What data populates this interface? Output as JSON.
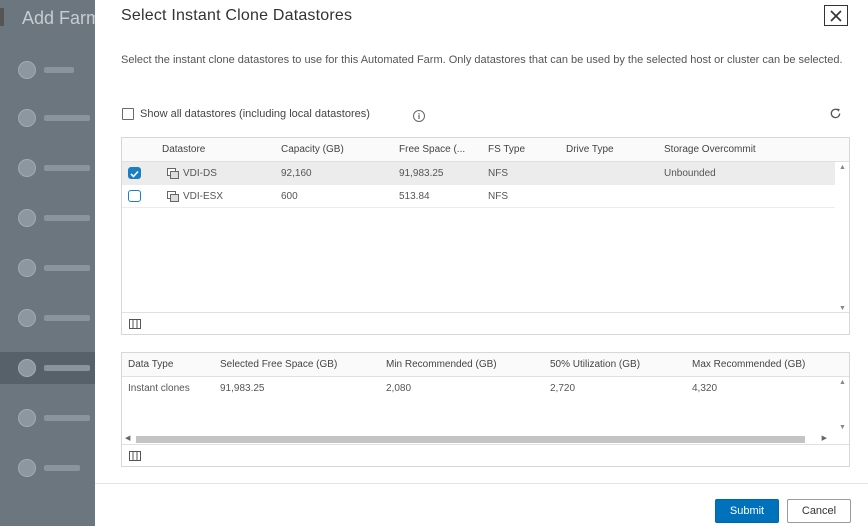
{
  "background": {
    "title": "Add Farm"
  },
  "modal": {
    "title": "Select Instant Clone Datastores",
    "description": "Select the instant clone datastores to use for this Automated Farm. Only datastores that can be used by the selected host or cluster can be selected.",
    "show_all_label": "Show all datastores (including local datastores)",
    "info_icon": "i"
  },
  "datastore_grid": {
    "columns": [
      "Datastore",
      "Capacity (GB)",
      "Free Space (...",
      "FS Type",
      "Drive Type",
      "Storage Overcommit"
    ],
    "rows": [
      {
        "selected": true,
        "datastore": "VDI-DS",
        "capacity": "92,160",
        "free_space": "91,983.25",
        "fs_type": "NFS",
        "drive_type": "",
        "overcommit": "Unbounded"
      },
      {
        "selected": false,
        "datastore": "VDI-ESX",
        "capacity": "600",
        "free_space": "513.84",
        "fs_type": "NFS",
        "drive_type": "",
        "overcommit": ""
      }
    ]
  },
  "summary_grid": {
    "columns": [
      "Data Type",
      "Selected Free Space (GB)",
      "Min Recommended (GB)",
      "50% Utilization (GB)",
      "Max Recommended (GB)"
    ],
    "rows": [
      {
        "data_type": "Instant clones",
        "selected_free": "91,983.25",
        "min_rec": "2,080",
        "util50": "2,720",
        "max_rec": "4,320"
      }
    ]
  },
  "footer": {
    "submit_label": "Submit",
    "cancel_label": "Cancel"
  },
  "colors": {
    "primary": "#0072bb",
    "checkbox": "#1b7ec2"
  }
}
